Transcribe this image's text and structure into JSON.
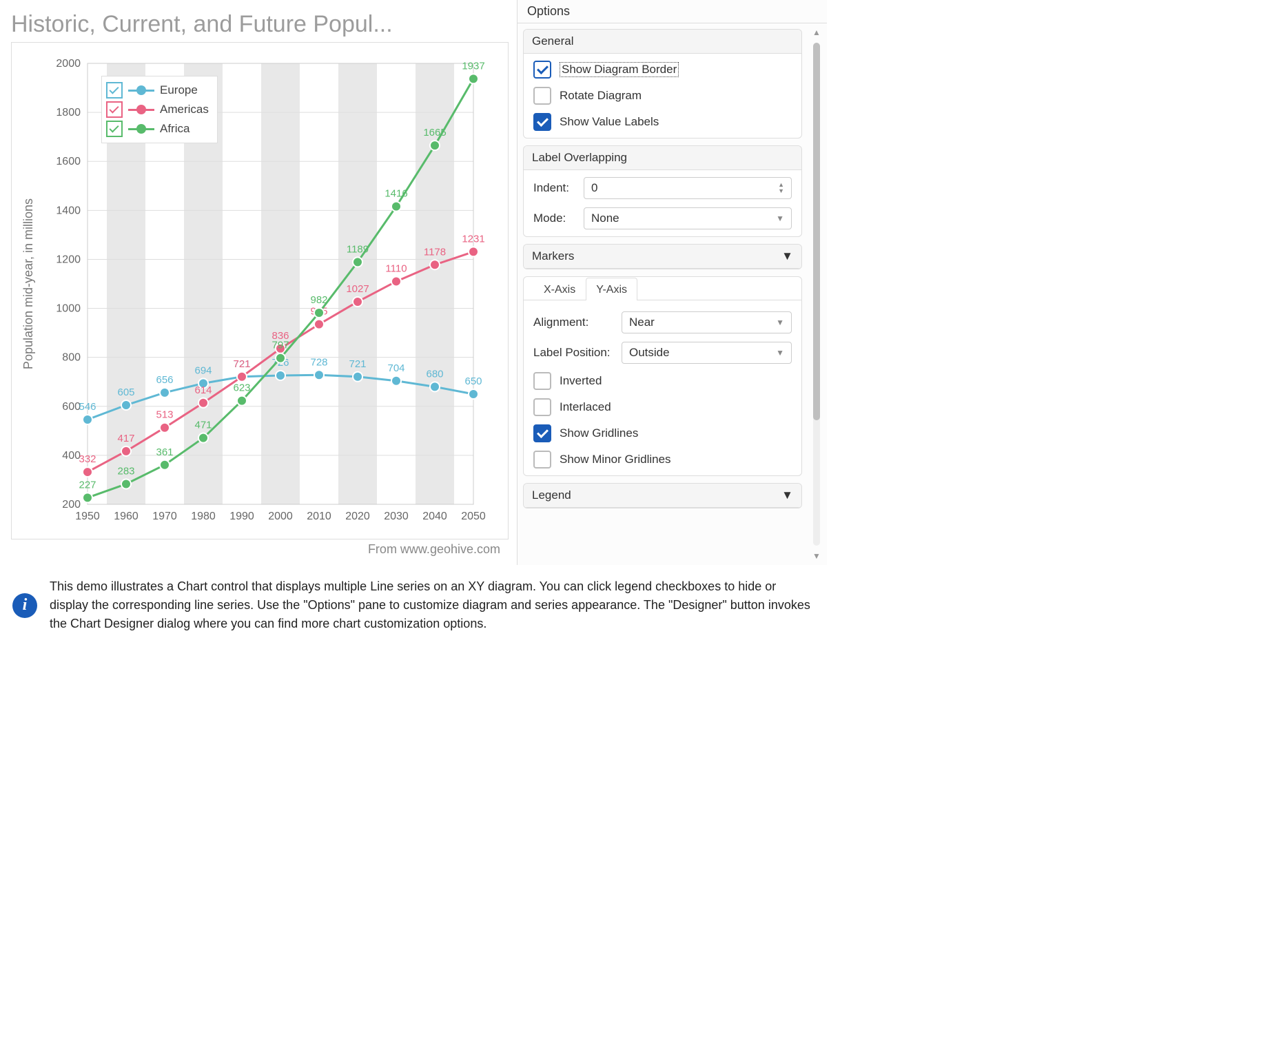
{
  "chart_data": {
    "type": "line",
    "title": "Historic, Current, and Future Popul...",
    "subtitle": "From www.geohive.com",
    "ylabel": "Population mid-year, in millions",
    "xlabel": "",
    "categories": [
      1950,
      1960,
      1970,
      1980,
      1990,
      2000,
      2010,
      2020,
      2030,
      2040,
      2050
    ],
    "ylim": [
      200,
      2000
    ],
    "yticks": [
      200,
      400,
      600,
      800,
      1000,
      1200,
      1400,
      1600,
      1800,
      2000
    ],
    "series": [
      {
        "name": "Europe",
        "color": "#5fb8d4",
        "values": [
          546,
          605,
          656,
          694,
          721,
          726,
          728,
          721,
          704,
          680,
          650
        ]
      },
      {
        "name": "Americas",
        "color": "#e96383",
        "values": [
          332,
          417,
          513,
          614,
          721,
          836,
          935,
          1027,
          1110,
          1178,
          1231
        ]
      },
      {
        "name": "Africa",
        "color": "#58bb6b",
        "values": [
          227,
          283,
          361,
          471,
          623,
          797,
          982,
          1189,
          1416,
          1665,
          1937
        ]
      }
    ]
  },
  "options": {
    "title": "Options",
    "general": {
      "title": "General",
      "show_border": "Show Diagram Border",
      "rotate": "Rotate Diagram",
      "show_labels": "Show Value Labels"
    },
    "label_overlap": {
      "title": "Label Overlapping",
      "indent_label": "Indent:",
      "indent_value": "0",
      "mode_label": "Mode:",
      "mode_value": "None"
    },
    "markers": {
      "title": "Markers"
    },
    "axis": {
      "tab_x": "X-Axis",
      "tab_y": "Y-Axis",
      "alignment_label": "Alignment:",
      "alignment_value": "Near",
      "labelpos_label": "Label Position:",
      "labelpos_value": "Outside",
      "inverted": "Inverted",
      "interlaced": "Interlaced",
      "gridlines": "Show Gridlines",
      "minor_gridlines": "Show Minor Gridlines"
    },
    "legend": {
      "title": "Legend"
    }
  },
  "info": "This demo illustrates a Chart control that displays multiple Line series on an XY diagram. You can click legend checkboxes to hide or display the corresponding line series. Use the \"Options\" pane to customize diagram and series appearance. The \"Designer\" button invokes the Chart Designer dialog where you can find more chart customization options."
}
